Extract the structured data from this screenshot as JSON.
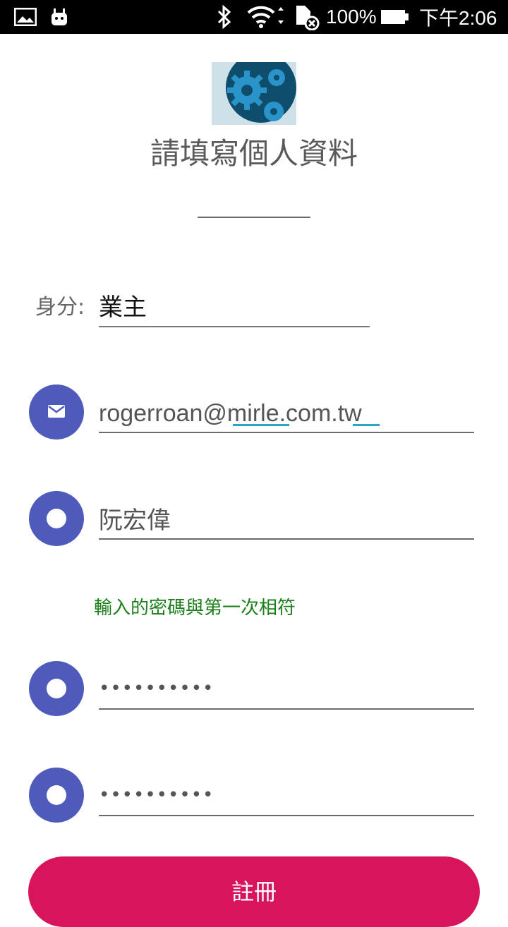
{
  "status_bar": {
    "battery": "100%",
    "time": "下午2:06"
  },
  "header": {
    "logo": "gears-icon",
    "title": "請填寫個人資料"
  },
  "form": {
    "role_label": "身分:",
    "role_value": "業主",
    "email": {
      "icon": "mail-icon",
      "value": "rogerroan@mirle.com.tw"
    },
    "name": {
      "icon": "circle-icon",
      "value": "阮宏偉"
    },
    "password_hint": "輸入的密碼與第一次相符",
    "password": {
      "icon": "circle-icon",
      "value": "••••••••••"
    },
    "password_confirm": {
      "icon": "circle-icon",
      "value": "••••••••••"
    },
    "register_label": "註冊"
  },
  "colors": {
    "accent": "#4e5bba",
    "button": "#d8145c",
    "hint": "#1a7f1a"
  }
}
